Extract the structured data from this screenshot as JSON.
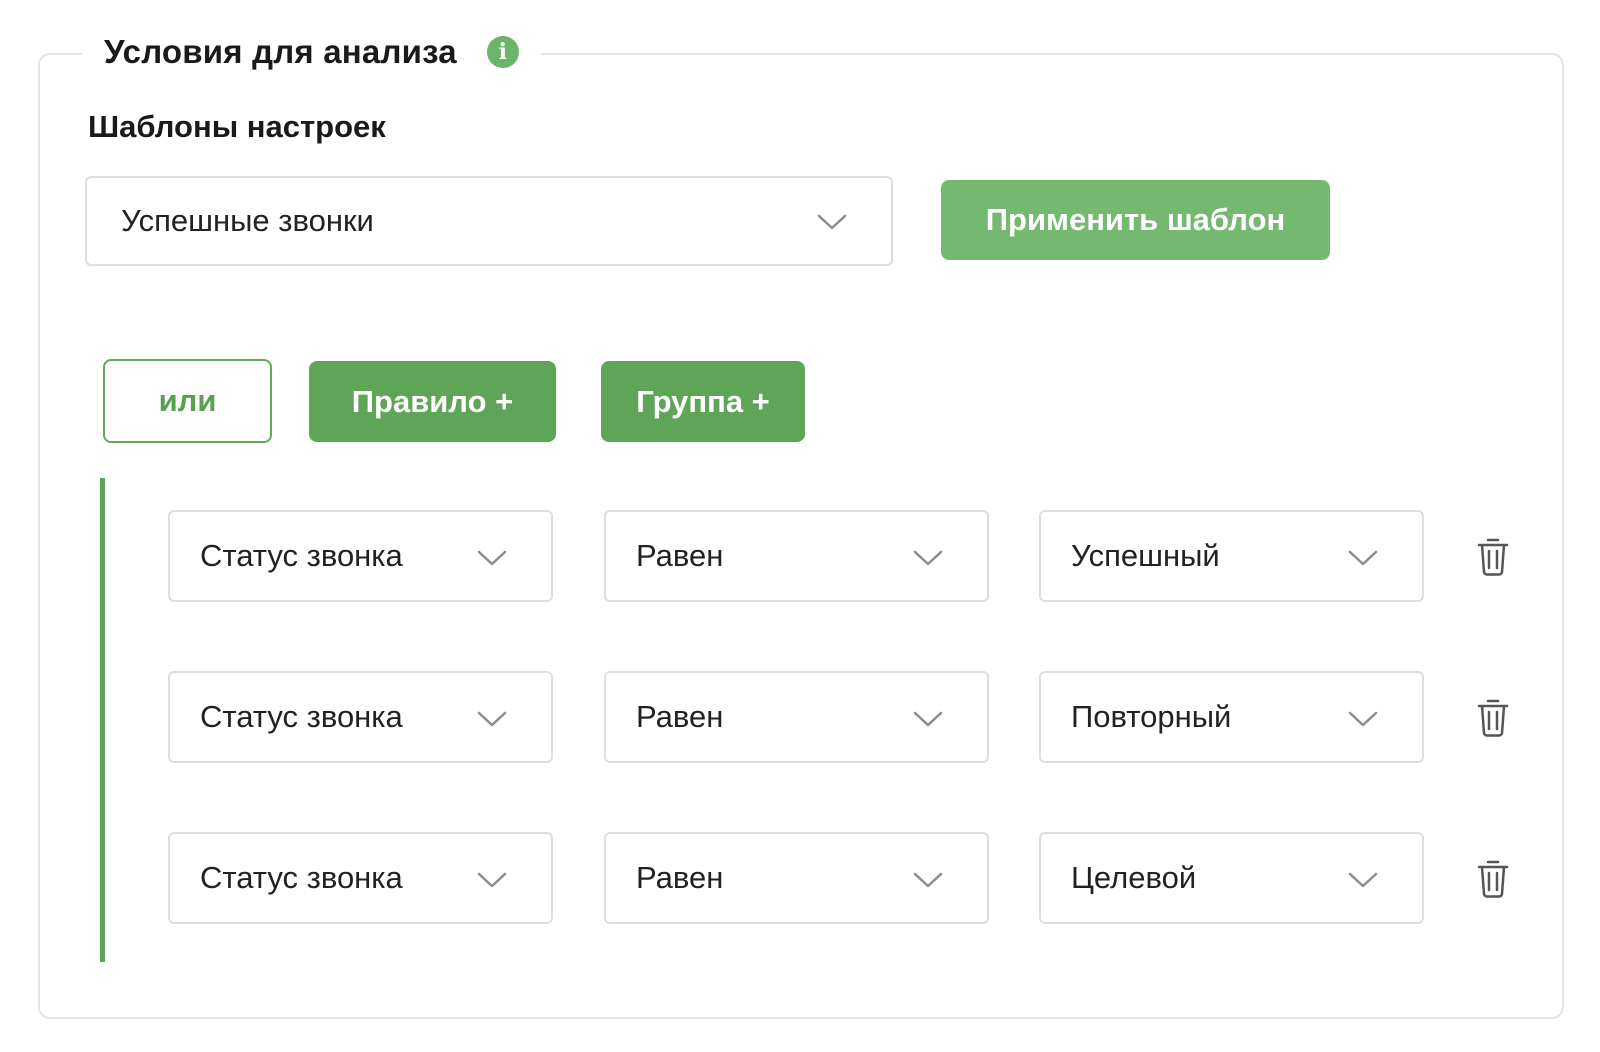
{
  "header": {
    "title": "Условия для анализа",
    "info_icon": "info-icon"
  },
  "templates": {
    "label": "Шаблоны настроек",
    "selected": "Успешные звонки",
    "apply_button": "Применить шаблон"
  },
  "group_controls": {
    "operator_button": "или",
    "add_rule_button": "Правило +",
    "add_group_button": "Группа +"
  },
  "rules": [
    {
      "field": "Статус звонка",
      "operator": "Равен",
      "value": "Успешный"
    },
    {
      "field": "Статус звонка",
      "operator": "Равен",
      "value": "Повторный"
    },
    {
      "field": "Статус звонка",
      "operator": "Равен",
      "value": "Целевой"
    }
  ],
  "colors": {
    "accent_green": "#5ea557",
    "light_green": "#74b96f",
    "border_gray": "#dedede"
  }
}
